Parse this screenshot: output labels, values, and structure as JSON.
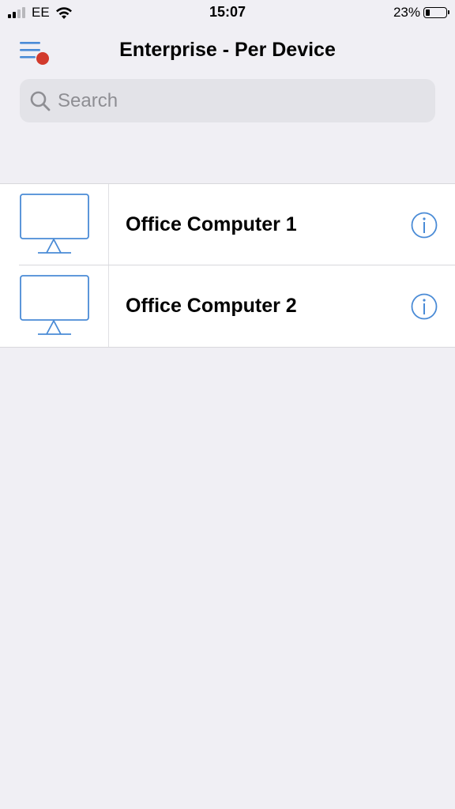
{
  "status_bar": {
    "carrier": "EE",
    "time": "15:07",
    "battery_percent": "23%",
    "battery_level": 0.23,
    "signal_bars_active": 2,
    "signal_bars_total": 4
  },
  "header": {
    "title": "Enterprise - Per Device",
    "menu_icon": "hamburger-menu-icon",
    "notification_dot_color": "#d23a2c"
  },
  "search": {
    "placeholder": "Search",
    "value": "",
    "icon": "search-icon"
  },
  "devices": [
    {
      "name": "Office Computer 1",
      "icon": "monitor-icon",
      "info_icon": "info-icon"
    },
    {
      "name": "Office Computer 2",
      "icon": "monitor-icon",
      "info_icon": "info-icon"
    }
  ],
  "colors": {
    "accent": "#4a8bd6",
    "background": "#f0eff4"
  }
}
